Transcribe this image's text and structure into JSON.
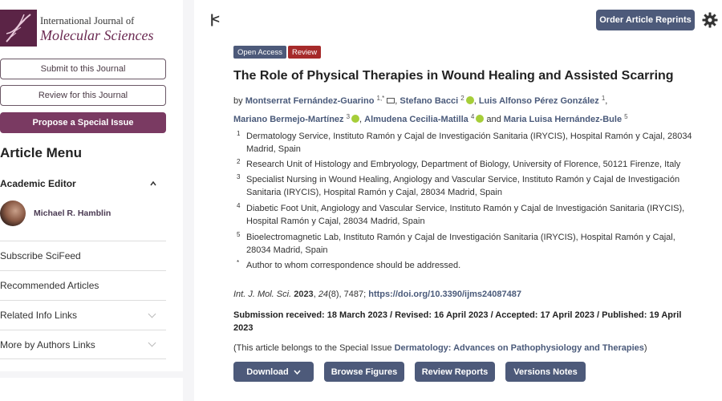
{
  "journal": {
    "name_line1": "International Journal of",
    "name_line2": "Molecular Sciences"
  },
  "sidebar": {
    "submit_label": "Submit to this Journal",
    "review_label": "Review for this Journal",
    "propose_label": "Propose a Special Issue",
    "menu_title": "Article Menu",
    "academic_editor_label": "Academic Editor",
    "editor_name": "Michael R. Hamblin",
    "links": [
      "Subscribe SciFeed",
      "Recommended Articles",
      "Related Info Links",
      "More by Authors Links"
    ]
  },
  "header": {
    "reprints_label": "Order Article Reprints",
    "collapse_glyph": "|<"
  },
  "article": {
    "badges": [
      "Open Access",
      "Review"
    ],
    "title": "The Role of Physical Therapies in Wound Healing and Assisted Scarring",
    "by": "by",
    "authors": [
      {
        "name": "Montserrat Fernández-Guarino",
        "sup": "1,*"
      },
      {
        "name": "Stefano Bacci",
        "sup": "2"
      },
      {
        "name": "Luis Alfonso Pérez González",
        "sup": "1"
      },
      {
        "name": "Mariano Bermejo-Martínez",
        "sup": "3"
      },
      {
        "name": "Almudena Cecilia-Matilla",
        "sup": "4"
      },
      {
        "name": "Maria Luisa Hernández-Bule",
        "sup": "5"
      }
    ],
    "and": "and",
    "affiliations": [
      {
        "n": "1",
        "text": "Dermatology Service, Instituto Ramón y Cajal de Investigación Sanitaria (IRYCIS), Hospital Ramón y Cajal, 28034 Madrid, Spain"
      },
      {
        "n": "2",
        "text": "Research Unit of Histology and Embryology, Department of Biology, University of Florence, 50121 Firenze, Italy"
      },
      {
        "n": "3",
        "text": "Specialist Nursing in Wound Healing, Angiology and Vascular Service, Instituto Ramón y Cajal de Investigación Sanitaria (IRYCIS), Hospital Ramón y Cajal, 28034 Madrid, Spain"
      },
      {
        "n": "4",
        "text": "Diabetic Foot Unit, Angiology and Vascular Service, Instituto Ramón y Cajal de Investigación Sanitaria (IRYCIS), Hospital Ramón y Cajal, 28034 Madrid, Spain"
      },
      {
        "n": "5",
        "text": "Bioelectromagnetic Lab, Instituto Ramón y Cajal de Investigación Sanitaria (IRYCIS), Hospital Ramón y Cajal, 28034 Madrid, Spain"
      },
      {
        "n": "*",
        "text": "Author to whom correspondence should be addressed."
      }
    ],
    "citation": {
      "journal_abbr": "Int. J. Mol. Sci.",
      "year": "2023",
      "volume": "24",
      "issue_pages": "(8), 7487;",
      "doi": "https://doi.org/10.3390/ijms24087487"
    },
    "dates": "Submission received: 18 March 2023 / Revised: 16 April 2023 / Accepted: 17 April 2023 / Published: 19 April 2023",
    "special_issue_prefix": "(This article belongs to the Special Issue",
    "special_issue_name": "Dermatology: Advances on Pathophysiology and Therapies",
    "special_issue_suffix": ")"
  },
  "actions": {
    "download": "Download",
    "browse_figures": "Browse Figures",
    "review_reports": "Review Reports",
    "versions_notes": "Versions Notes"
  },
  "colors": {
    "brand": "#7a3a62",
    "button": "#4d5a7a",
    "review_badge": "#a62a2a",
    "orcid": "#a6ce39"
  }
}
